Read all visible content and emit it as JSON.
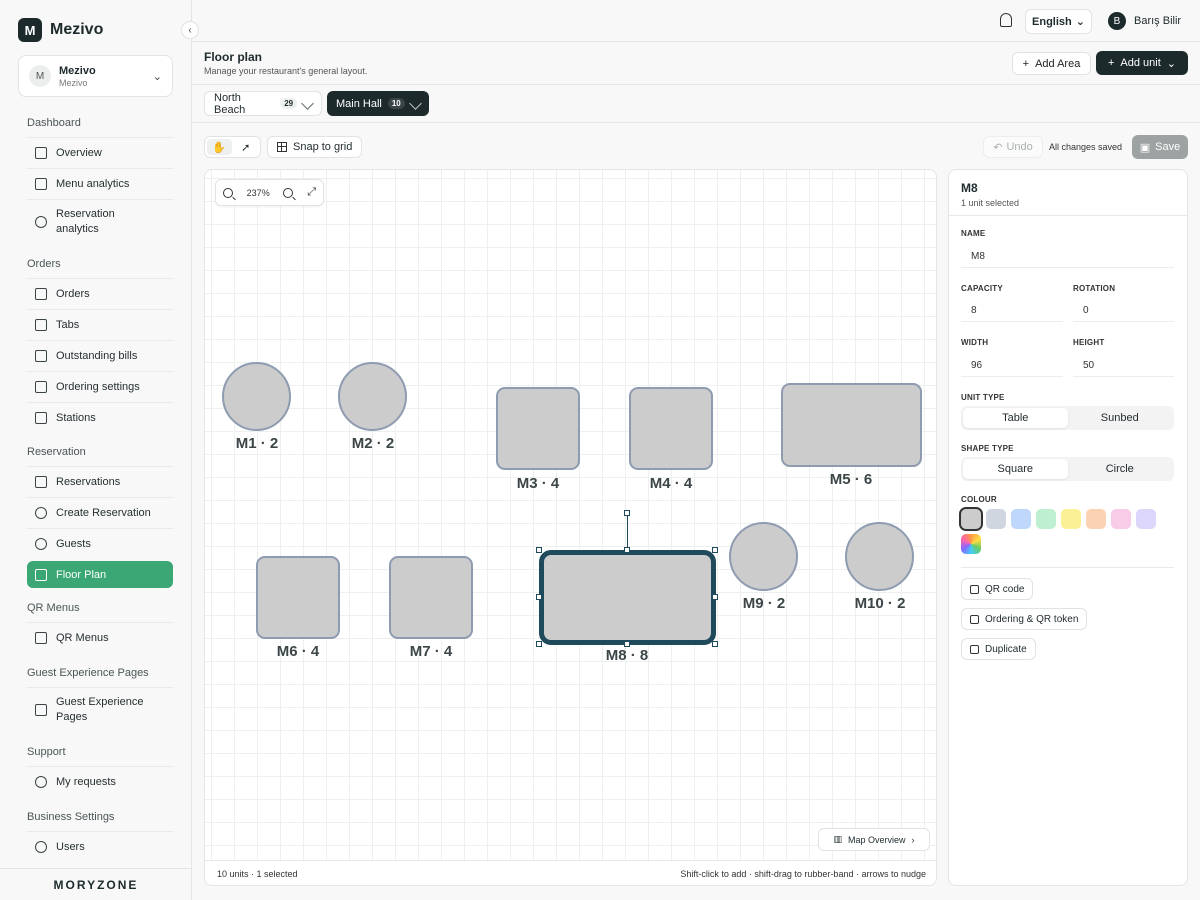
{
  "brand": {
    "logo_letter": "M",
    "name": "Mezivo"
  },
  "workspace": {
    "avatar": "M",
    "name": "Mezivo",
    "sub": "Mezivo"
  },
  "sidebar": {
    "dashboard": "Dashboard",
    "overview": "Overview",
    "menu_analytics": "Menu analytics",
    "reservation_analytics": "Reservation analytics",
    "orders_section": "Orders",
    "orders": "Orders",
    "tabs": "Tabs",
    "outstanding_bills": "Outstanding bills",
    "ordering_settings": "Ordering settings",
    "stations": "Stations",
    "reservation_section": "Reservation",
    "reservations": "Reservations",
    "create_reservation": "Create Reservation",
    "guests": "Guests",
    "floor_plan": "Floor Plan",
    "qr_section": "QR Menus",
    "qr_menus": "QR Menus",
    "gep_section": "Guest Experience Pages",
    "gep": "Guest Experience Pages",
    "support_section": "Support",
    "my_requests": "My requests",
    "business_section": "Business Settings",
    "users": "Users",
    "footer_logo": "MORYZONE"
  },
  "topbar": {
    "language": "English",
    "user_initial": "B",
    "user_name": "Barış Bilir"
  },
  "header": {
    "title": "Floor plan",
    "subtitle": "Manage your restaurant's general layout.",
    "add_area": "Add Area",
    "add_unit": "Add unit"
  },
  "areas": [
    {
      "name": "North Beach",
      "count": "29"
    },
    {
      "name": "Main Hall",
      "count": "10"
    }
  ],
  "toolbar": {
    "snap": "Snap to grid",
    "undo": "Undo",
    "saved": "All changes saved",
    "save": "Save",
    "zoom": "237%"
  },
  "units": [
    {
      "name": "M1",
      "capacity": 2,
      "label": "M1 · 2"
    },
    {
      "name": "M2",
      "capacity": 2,
      "label": "M2 · 2"
    },
    {
      "name": "M3",
      "capacity": 4,
      "label": "M3 · 4"
    },
    {
      "name": "M4",
      "capacity": 4,
      "label": "M4 · 4"
    },
    {
      "name": "M5",
      "capacity": 6,
      "label": "M5 · 6"
    },
    {
      "name": "M6",
      "capacity": 4,
      "label": "M6 · 4"
    },
    {
      "name": "M7",
      "capacity": 4,
      "label": "M7 · 4"
    },
    {
      "name": "M8",
      "capacity": 8,
      "label": "M8 · 8"
    },
    {
      "name": "M9",
      "capacity": 2,
      "label": "M9 · 2"
    },
    {
      "name": "M10",
      "capacity": 2,
      "label": "M10 · 2"
    }
  ],
  "canvas": {
    "map_overview": "Map Overview",
    "status": "10 units · 1 selected",
    "hint": "Shift-click to add · shift-drag to rubber-band · arrows to nudge"
  },
  "panel": {
    "title": "M8",
    "sub": "1 unit selected",
    "name_label": "NAME",
    "name_value": "M8",
    "capacity_label": "CAPACITY",
    "capacity_value": "8",
    "rotation_label": "ROTATION",
    "rotation_value": "0",
    "width_label": "WIDTH",
    "width_value": "96",
    "height_label": "HEIGHT",
    "height_value": "50",
    "unit_type_label": "UNIT TYPE",
    "unit_type_options": [
      "Table",
      "Sunbed"
    ],
    "shape_type_label": "SHAPE TYPE",
    "shape_type_options": [
      "Square",
      "Circle"
    ],
    "colour_label": "COLOUR",
    "colours": [
      "#cccccc",
      "#cfd6df",
      "#bfd7fb",
      "#bdefd0",
      "#fbf094",
      "#fbd3b2",
      "#f8cbe6",
      "#dcd6fb"
    ],
    "qr_code": "QR code",
    "ordering_token": "Ordering & QR token",
    "duplicate": "Duplicate"
  },
  "colors": {
    "accent": "#3aa774",
    "dark": "#1d2a2c",
    "selected_border": "#1e4a5c"
  }
}
